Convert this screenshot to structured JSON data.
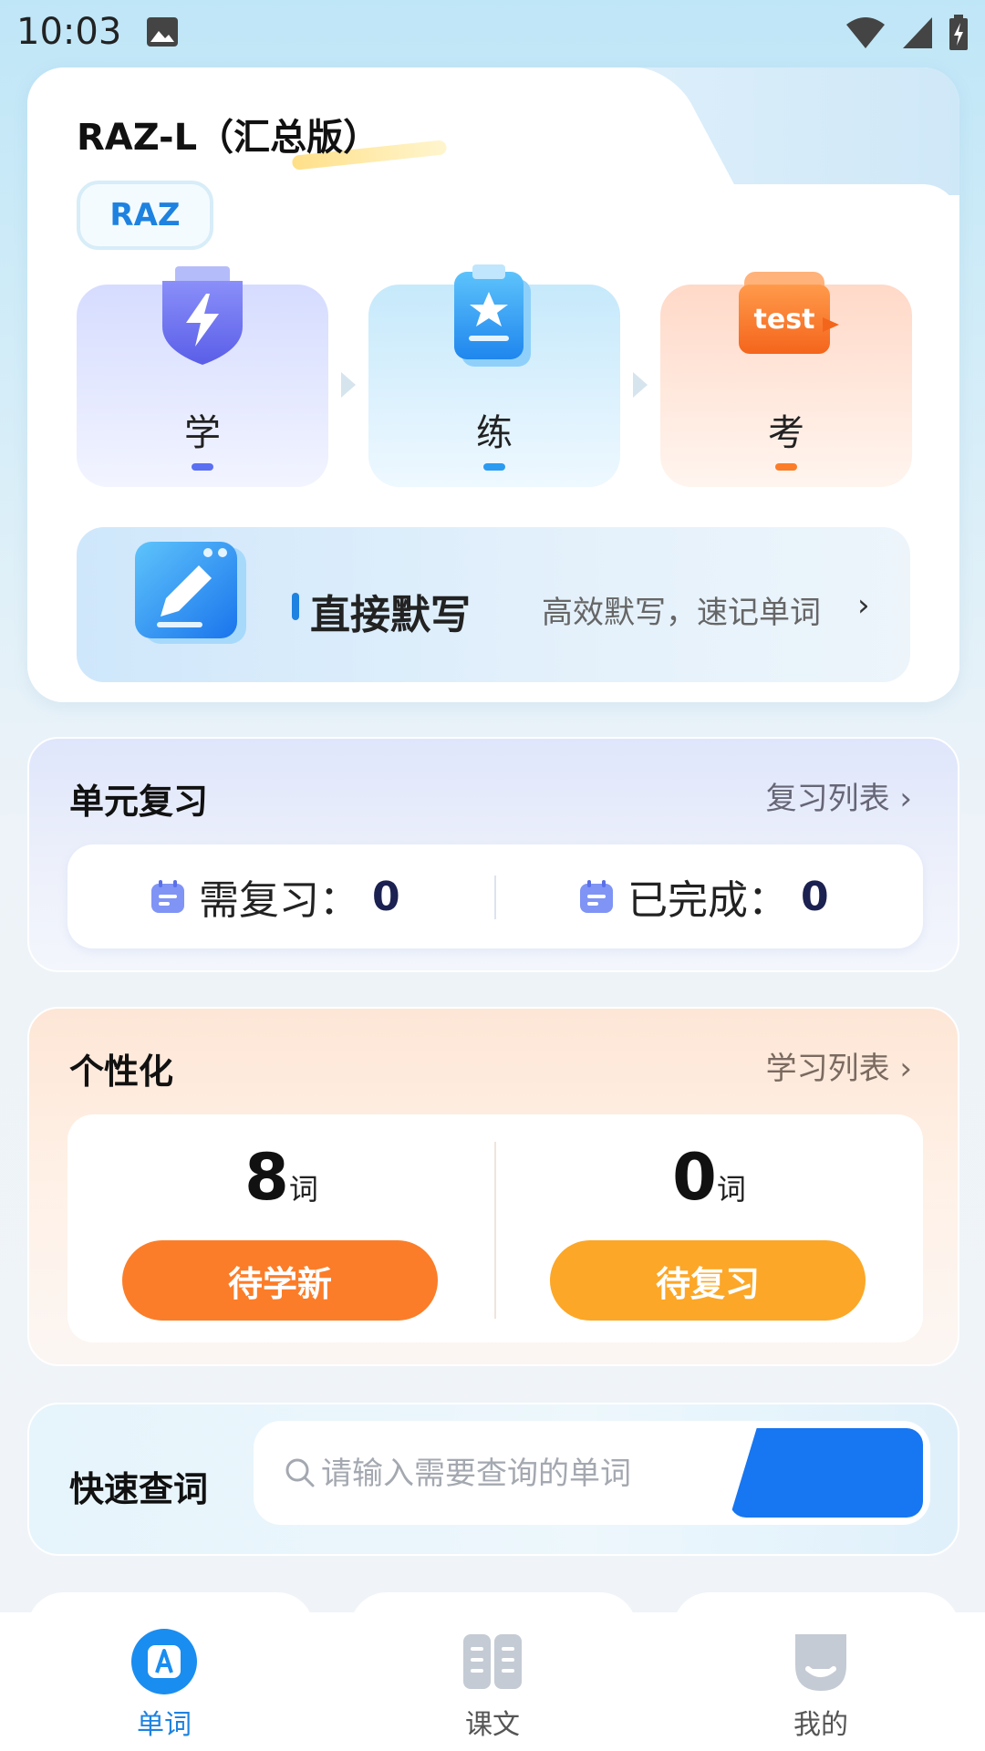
{
  "status_bar": {
    "time": "10:03"
  },
  "book": {
    "title": "RAZ-L（汇总版）",
    "tag": "RAZ"
  },
  "steps": [
    {
      "label": "学",
      "dash_color": "#5b6ff2"
    },
    {
      "label": "练",
      "dash_color": "#2a9bf0"
    },
    {
      "label": "考",
      "dash_color": "#fb7d29"
    }
  ],
  "step_icons": {
    "test_badge": "test"
  },
  "dictation": {
    "title": "直接默写",
    "subtitle": "高效默写，速记单词",
    "chevron": "›"
  },
  "review": {
    "title": "单元复习",
    "link": "复习列表 ›",
    "need_label": "需复习：",
    "need_value": "0",
    "done_label": "已完成：",
    "done_value": "0"
  },
  "personal": {
    "title": "个性化",
    "link": "学习列表 ›",
    "new_count": "8",
    "review_count": "0",
    "unit": "词",
    "new_button": "待学新",
    "review_button": "待复习"
  },
  "search": {
    "label": "快速查词",
    "placeholder": "请输入需要查询的单词"
  },
  "nav": [
    {
      "label": "单词",
      "icon": "word-icon",
      "active": true
    },
    {
      "label": "课文",
      "icon": "book-icon",
      "active": false
    },
    {
      "label": "我的",
      "icon": "profile-icon",
      "active": false
    }
  ],
  "colors": {
    "accent": "#1e82e0",
    "orange": "#fb7d29",
    "yellow": "#fca727",
    "navy": "#1b2150"
  }
}
